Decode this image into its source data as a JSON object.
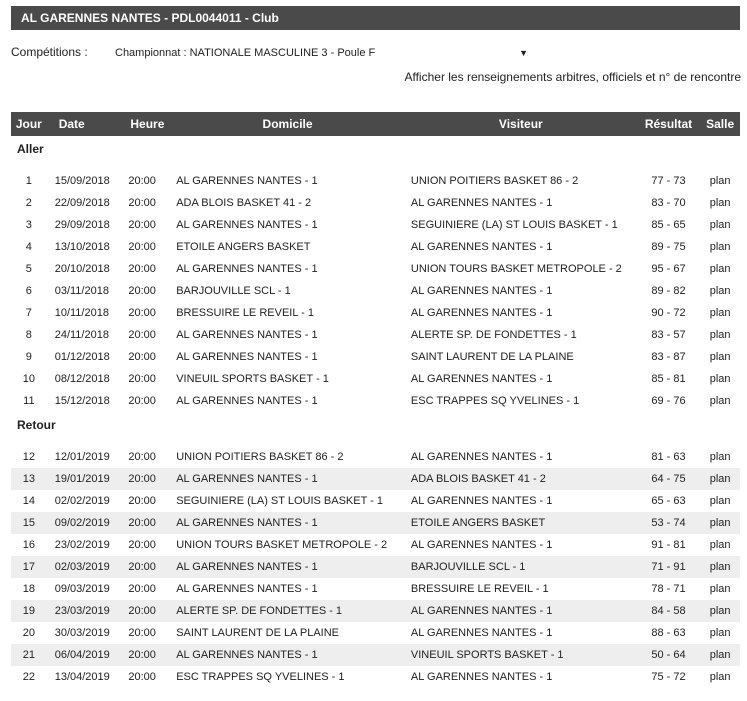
{
  "header": {
    "title": "AL GARENNES NANTES - PDL0044011 - Club"
  },
  "competition": {
    "label": "Compétitions :",
    "selected": "Championnat : NATIONALE MASCULINE 3 - Poule F",
    "arrow": "▼"
  },
  "info_link": "Afficher les renseignements arbitres, officiels et n° de rencontre",
  "columns": {
    "jour": "Jour",
    "date": "Date",
    "heure": "Heure",
    "domicile": "Domicile",
    "visiteur": "Visiteur",
    "resultat": "Résultat",
    "salle": "Salle"
  },
  "sections": [
    {
      "label": "Aller",
      "rows": [
        {
          "jour": "1",
          "date": "15/09/2018",
          "heure": "20:00",
          "domicile": "AL GARENNES NANTES - 1",
          "visiteur": "UNION POITIERS BASKET 86 - 2",
          "resultat": "77 - 73",
          "salle": "plan"
        },
        {
          "jour": "2",
          "date": "22/09/2018",
          "heure": "20:00",
          "domicile": "ADA BLOIS BASKET 41 - 2",
          "visiteur": "AL GARENNES NANTES - 1",
          "resultat": "83 - 70",
          "salle": "plan"
        },
        {
          "jour": "3",
          "date": "29/09/2018",
          "heure": "20:00",
          "domicile": "AL GARENNES NANTES - 1",
          "visiteur": "SEGUINIERE (LA) ST LOUIS BASKET - 1",
          "resultat": "85 - 65",
          "salle": "plan"
        },
        {
          "jour": "4",
          "date": "13/10/2018",
          "heure": "20:00",
          "domicile": "ETOILE ANGERS BASKET",
          "visiteur": "AL GARENNES NANTES - 1",
          "resultat": "89 - 75",
          "salle": "plan"
        },
        {
          "jour": "5",
          "date": "20/10/2018",
          "heure": "20:00",
          "domicile": "AL GARENNES NANTES - 1",
          "visiteur": "UNION TOURS BASKET METROPOLE - 2",
          "resultat": "95 - 67",
          "salle": "plan"
        },
        {
          "jour": "6",
          "date": "03/11/2018",
          "heure": "20:00",
          "domicile": "BARJOUVILLE SCL - 1",
          "visiteur": "AL GARENNES NANTES - 1",
          "resultat": "89 - 82",
          "salle": "plan"
        },
        {
          "jour": "7",
          "date": "10/11/2018",
          "heure": "20:00",
          "domicile": "BRESSUIRE LE REVEIL - 1",
          "visiteur": "AL GARENNES NANTES - 1",
          "resultat": "90 - 72",
          "salle": "plan"
        },
        {
          "jour": "8",
          "date": "24/11/2018",
          "heure": "20:00",
          "domicile": "AL GARENNES NANTES - 1",
          "visiteur": "ALERTE SP. DE FONDETTES - 1",
          "resultat": "83 - 57",
          "salle": "plan"
        },
        {
          "jour": "9",
          "date": "01/12/2018",
          "heure": "20:00",
          "domicile": "AL GARENNES NANTES - 1",
          "visiteur": "SAINT LAURENT DE LA PLAINE",
          "resultat": "83 - 87",
          "salle": "plan"
        },
        {
          "jour": "10",
          "date": "08/12/2018",
          "heure": "20:00",
          "domicile": "VINEUIL SPORTS BASKET - 1",
          "visiteur": "AL GARENNES NANTES - 1",
          "resultat": "85 - 81",
          "salle": "plan"
        },
        {
          "jour": "11",
          "date": "15/12/2018",
          "heure": "20:00",
          "domicile": "AL GARENNES NANTES - 1",
          "visiteur": "ESC TRAPPES SQ YVELINES - 1",
          "resultat": "69 - 76",
          "salle": "plan"
        }
      ]
    },
    {
      "label": "Retour",
      "rows": [
        {
          "jour": "12",
          "date": "12/01/2019",
          "heure": "20:00",
          "domicile": "UNION POITIERS BASKET 86 - 2",
          "visiteur": "AL GARENNES NANTES - 1",
          "resultat": "81 - 63",
          "salle": "plan"
        },
        {
          "jour": "13",
          "date": "19/01/2019",
          "heure": "20:00",
          "domicile": "AL GARENNES NANTES - 1",
          "visiteur": "ADA BLOIS BASKET 41 - 2",
          "resultat": "64 - 75",
          "salle": "plan"
        },
        {
          "jour": "14",
          "date": "02/02/2019",
          "heure": "20:00",
          "domicile": "SEGUINIERE (LA) ST LOUIS BASKET - 1",
          "visiteur": "AL GARENNES NANTES - 1",
          "resultat": "65 - 63",
          "salle": "plan"
        },
        {
          "jour": "15",
          "date": "09/02/2019",
          "heure": "20:00",
          "domicile": "AL GARENNES NANTES - 1",
          "visiteur": "ETOILE ANGERS BASKET",
          "resultat": "53 - 74",
          "salle": "plan"
        },
        {
          "jour": "16",
          "date": "23/02/2019",
          "heure": "20:00",
          "domicile": "UNION TOURS BASKET METROPOLE - 2",
          "visiteur": "AL GARENNES NANTES - 1",
          "resultat": "91 - 81",
          "salle": "plan"
        },
        {
          "jour": "17",
          "date": "02/03/2019",
          "heure": "20:00",
          "domicile": "AL GARENNES NANTES - 1",
          "visiteur": "BARJOUVILLE SCL - 1",
          "resultat": "71 - 91",
          "salle": "plan"
        },
        {
          "jour": "18",
          "date": "09/03/2019",
          "heure": "20:00",
          "domicile": "AL GARENNES NANTES - 1",
          "visiteur": "BRESSUIRE LE REVEIL - 1",
          "resultat": "78 - 71",
          "salle": "plan"
        },
        {
          "jour": "19",
          "date": "23/03/2019",
          "heure": "20:00",
          "domicile": "ALERTE SP. DE FONDETTES - 1",
          "visiteur": "AL GARENNES NANTES - 1",
          "resultat": "84 - 58",
          "salle": "plan"
        },
        {
          "jour": "20",
          "date": "30/03/2019",
          "heure": "20:00",
          "domicile": "SAINT LAURENT DE LA PLAINE",
          "visiteur": "AL GARENNES NANTES - 1",
          "resultat": "88 - 63",
          "salle": "plan"
        },
        {
          "jour": "21",
          "date": "06/04/2019",
          "heure": "20:00",
          "domicile": "AL GARENNES NANTES - 1",
          "visiteur": "VINEUIL SPORTS BASKET - 1",
          "resultat": "50 - 64",
          "salle": "plan"
        },
        {
          "jour": "22",
          "date": "13/04/2019",
          "heure": "20:00",
          "domicile": "ESC TRAPPES SQ YVELINES - 1",
          "visiteur": "AL GARENNES NANTES - 1",
          "resultat": "75 - 72",
          "salle": "plan"
        }
      ]
    }
  ]
}
